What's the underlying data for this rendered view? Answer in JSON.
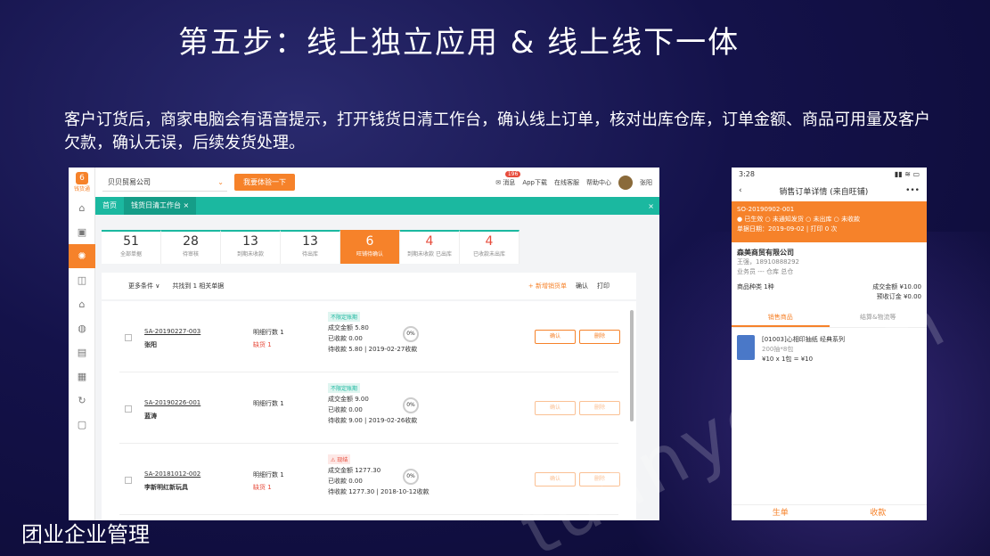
{
  "slide": {
    "title": "第五步：线上独立应用 & 线上线下一体",
    "description": "客户订货后，商家电脑会有语音提示，打开钱货日清工作台，确认线上订单，核对出库仓库，订单金额、商品可用量及客户欠款，确认无误，后续发货处理。",
    "footer": "团业企业管理",
    "watermark": "tuanye.com"
  },
  "desktop": {
    "logo_text": "钱货通",
    "company": "贝贝贸易公司",
    "trial_button": "我要体验一下",
    "top_links": {
      "messages": "消息",
      "messages_badge": "196",
      "app": "App下载",
      "service": "在线客服",
      "help": "帮助中心",
      "user": "张阳"
    },
    "tabs": [
      {
        "label": "首页"
      },
      {
        "label": "钱货日清工作台 ×"
      }
    ],
    "stats": [
      {
        "num": "51",
        "label": "全部单据"
      },
      {
        "num": "28",
        "label": "待审核"
      },
      {
        "num": "13",
        "label": "到期未收款"
      },
      {
        "num": "13",
        "label": "待出库"
      },
      {
        "num": "6",
        "label": "旺铺待确认"
      },
      {
        "num": "4",
        "label": "到期未收款 已出库"
      },
      {
        "num": "4",
        "label": "已收款未出库"
      }
    ],
    "toolbar": {
      "filter": "更多条件 ∨",
      "found": "共找到 1 相关单据",
      "new": "+ 新增销货单",
      "confirm": "确认",
      "print": "打印"
    },
    "rows": [
      {
        "code": "SA-20190227-003",
        "customer": "张阳",
        "lines": "明细行数 1",
        "owe": "缺货 1",
        "tag": "不限定账期",
        "amount": "成交金额 5.80",
        "received": "已收款 0.00",
        "due": "待收款 5.80 | 2019-02-27收款",
        "pct": "0%",
        "confirm": "确认",
        "delete": "删除"
      },
      {
        "code": "SA-20190226-001",
        "customer": "蓝涛",
        "lines": "明细行数 1",
        "owe": "",
        "tag": "不限定账期",
        "amount": "成交金额 9.00",
        "received": "已收款 0.00",
        "due": "待收款 9.00 | 2019-02-26收款",
        "pct": "0%",
        "confirm": "确认",
        "delete": "删除"
      },
      {
        "code": "SA-20181012-002",
        "customer": "李新明红新玩具",
        "lines": "明细行数 1",
        "owe": "缺货 1",
        "tag": "⚠ 现结",
        "amount": "成交金额 1277.30",
        "received": "已收款 0.00",
        "due": "待收款 1277.30 | 2018-10-12收款",
        "pct": "0%",
        "confirm": "确认",
        "delete": "删除"
      }
    ]
  },
  "mobile": {
    "time": "3:28",
    "signal": "▮▮ ≋ ▭",
    "back": "‹",
    "title": "销售订单详情 (来自旺铺)",
    "more": "•••",
    "order_no": "SO-20190902-001",
    "states": "● 已生效 ○ 未通知发货 ○ 未出库 ○ 未收款",
    "order_date": "单据日期：2019-09-02 | 打印 0 次",
    "customer": "森美商贸有限公司",
    "contact": "王强，18910888292",
    "salesman": "业务员 ---    仓库 总仓",
    "kinds": "商品种类 1种",
    "total": "成交金额 ¥10.00",
    "prepay": "预收订金 ¥0.00",
    "tabs": [
      "销售商品",
      "结算&物流等"
    ],
    "item_name": "[01003]心相印抽纸 经典系列",
    "item_spec": "200抽*8包",
    "item_qty": "¥10 x 1包 = ¥10",
    "bottom_left": "生单",
    "bottom_right": "收款"
  }
}
